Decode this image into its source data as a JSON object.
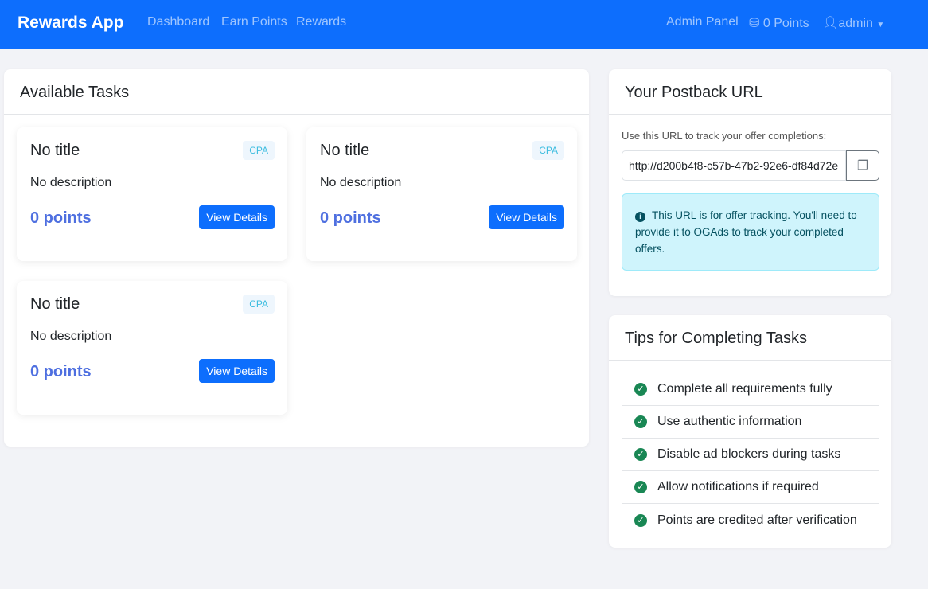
{
  "nav": {
    "brand": "Rewards App",
    "links": [
      "Dashboard",
      "Earn Points",
      "Rewards"
    ],
    "admin_panel": "Admin Panel",
    "points": "0 Points",
    "user": "admin"
  },
  "tasks": {
    "title": "Available Tasks",
    "items": [
      {
        "title": "No title",
        "badge": "CPA",
        "description": "No description",
        "points": "0 points",
        "button": "View Details"
      },
      {
        "title": "No title",
        "badge": "CPA",
        "description": "No description",
        "points": "0 points",
        "button": "View Details"
      },
      {
        "title": "No title",
        "badge": "CPA",
        "description": "No description",
        "points": "0 points",
        "button": "View Details"
      }
    ]
  },
  "postback": {
    "title": "Your Postback URL",
    "label": "Use this URL to track your offer completions:",
    "url": "http://d200b4f8-c57b-47b2-92e6-df84d72e",
    "info": "This URL is for offer tracking. You'll need to provide it to OGAds to track your completed offers."
  },
  "tips": {
    "title": "Tips for Completing Tasks",
    "items": [
      "Complete all requirements fully",
      "Use authentic information",
      "Disable ad blockers during tasks",
      "Allow notifications if required",
      "Points are credited after verification"
    ]
  },
  "colors": {
    "primary": "#0d6efd",
    "success": "#198754",
    "info_bg": "#cff4fc"
  }
}
